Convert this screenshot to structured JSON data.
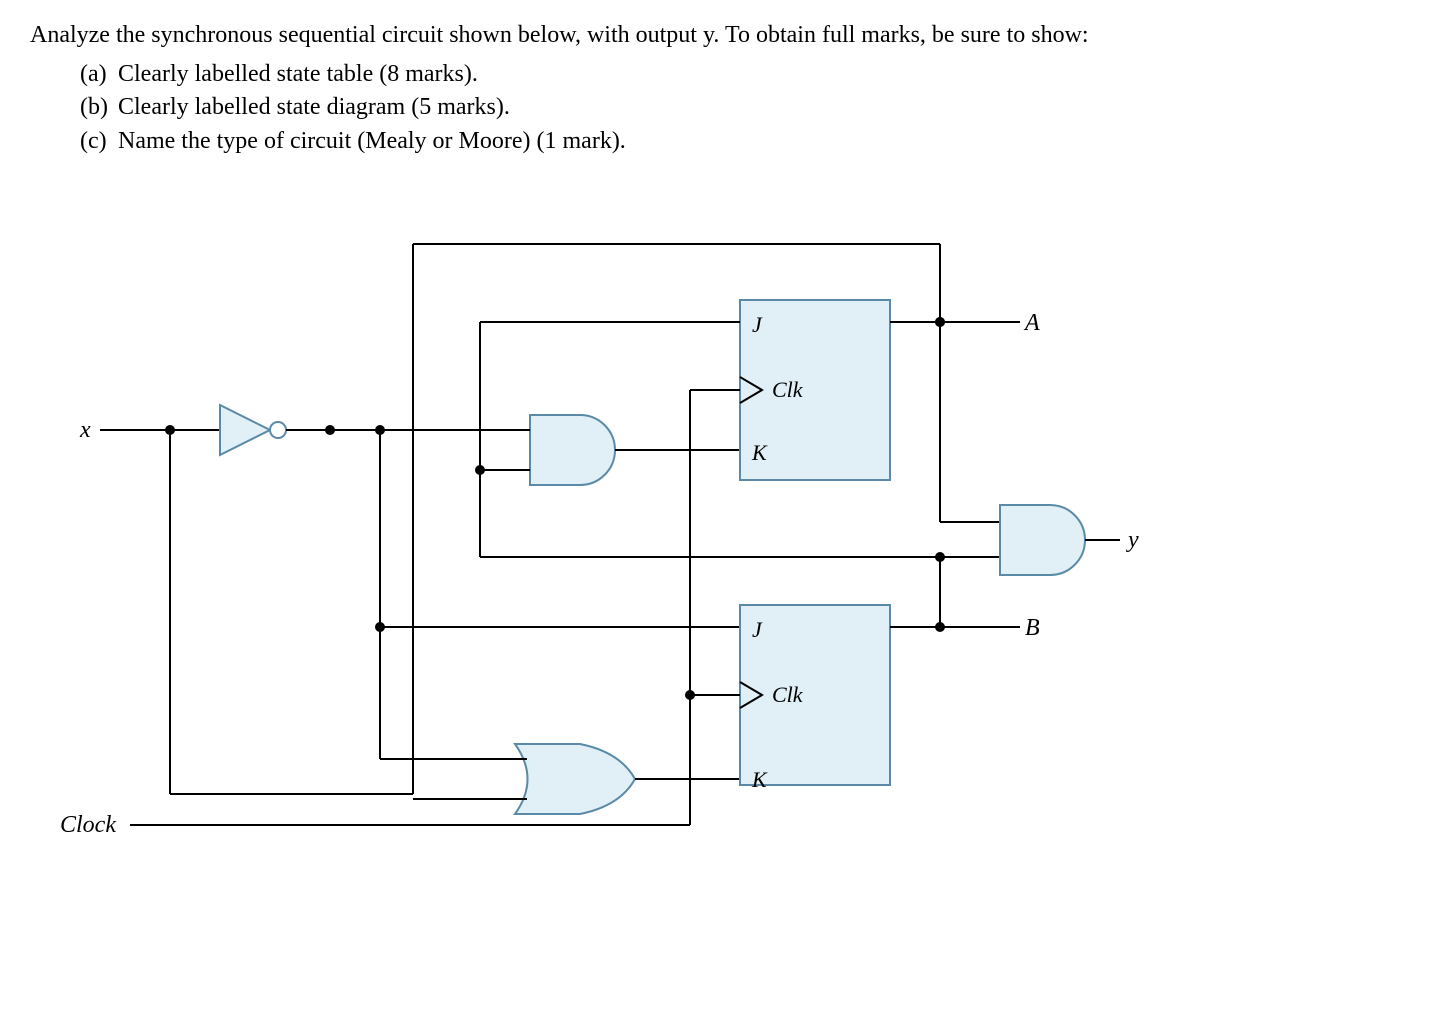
{
  "question": {
    "intro": "Analyze the synchronous sequential circuit shown below, with output y. To obtain full marks, be sure to show:",
    "parts": [
      {
        "label": "(a)",
        "text": "Clearly labelled state table (8 marks)."
      },
      {
        "label": "(b)",
        "text": "Clearly labelled state diagram (5 marks)."
      },
      {
        "label": "(c)",
        "text": "Name the type of circuit (Mealy or Moore) (1 mark)."
      }
    ]
  },
  "signals": {
    "input_x": "x",
    "clock": "Clock",
    "output_y": "y",
    "outA": "A",
    "outB": "B"
  },
  "flipflop": {
    "J": "J",
    "K": "K",
    "Clk": "Clk"
  },
  "circuit_description": {
    "type": "synchronous sequential",
    "flipflops": 2,
    "flipflop_type": "JK",
    "gates": [
      "NOT",
      "AND (2-input)",
      "OR (2-input)",
      "AND (2-input for output y)"
    ],
    "inputs": [
      "x",
      "Clock"
    ],
    "outputs": [
      "y"
    ],
    "state_vars": [
      "A",
      "B"
    ],
    "connections": {
      "JA": "B",
      "KA": "B AND x'",
      "JB": "x'",
      "KB": "A OR x'",
      "y": "A AND B"
    }
  }
}
